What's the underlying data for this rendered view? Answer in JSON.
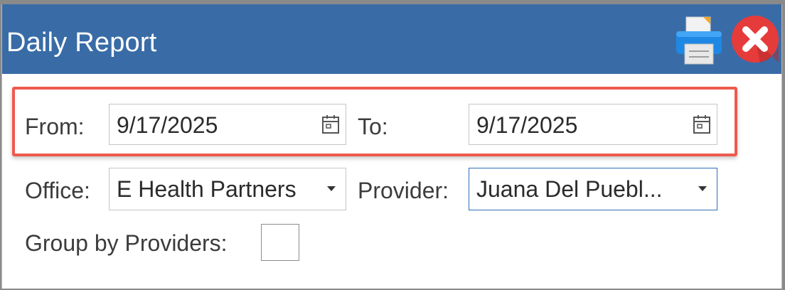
{
  "window": {
    "title": "Daily Report"
  },
  "toolbar": {
    "print_icon": "printer-icon",
    "close_icon": "close-icon"
  },
  "date_range": {
    "from_label": "From:",
    "from_value": "9/17/2025",
    "to_label": "To:",
    "to_value": "9/17/2025",
    "calendar_icon": "calendar-icon",
    "highlight_color": "#ee5a4e"
  },
  "filters": {
    "office_label": "Office:",
    "office_value": "E Health Partners",
    "provider_label": "Provider:",
    "provider_value": "Juana Del Puebl..."
  },
  "grouping": {
    "group_by_label": "Group by Providers:",
    "group_by_checked": false
  },
  "colors": {
    "titlebar": "#396ca6",
    "focus_border": "#2d6fba",
    "close_red": "#e63b3b"
  }
}
